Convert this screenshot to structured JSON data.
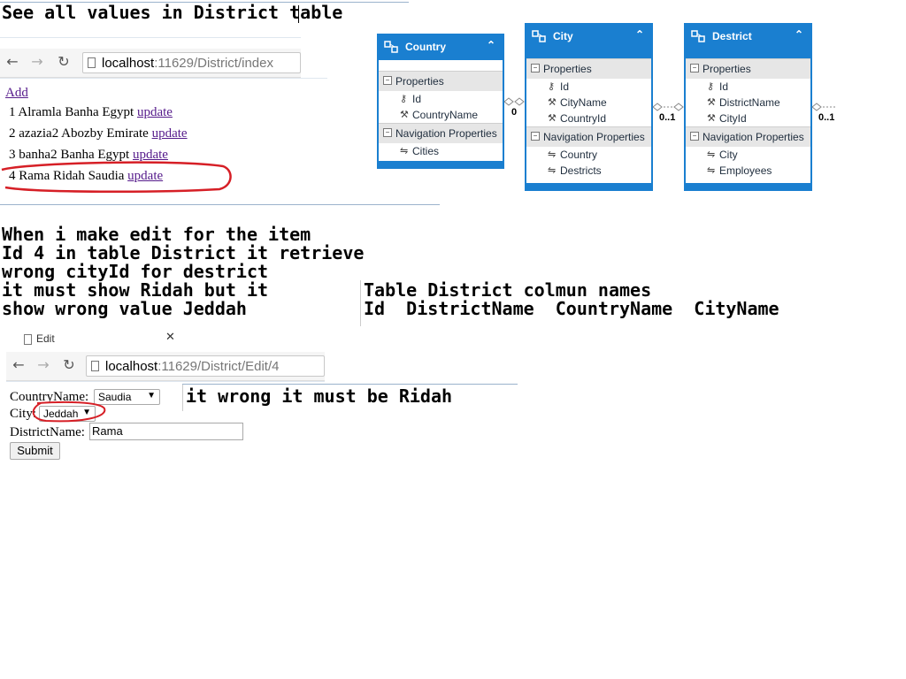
{
  "captions": {
    "top": "See all values in District table",
    "problem": [
      "When i make edit for the item",
      "Id 4 in table District it retrieve",
      "wrong cityId for destrict",
      "it must show Ridah but it",
      "show wrong value Jeddah"
    ],
    "columns_title": "Table District colmun names",
    "columns": "Id  DistrictName  CountryName  CityName",
    "wrong": "it wrong it must be Ridah"
  },
  "index_browser": {
    "url_host": "localhost",
    "url_rest": ":11629/District/index"
  },
  "index_page": {
    "add_link": "Add",
    "rows": [
      {
        "text": "1 Alramla Banha Egypt",
        "link": "update"
      },
      {
        "text": "2 azazia2 Abozby Emirate",
        "link": "update"
      },
      {
        "text": "3 banha2 Banha Egypt",
        "link": "update"
      },
      {
        "text": "4 Rama Ridah Saudia",
        "link": "update"
      }
    ]
  },
  "diagram": {
    "colors": {
      "header": "#1a7fd0",
      "section": "#e6e6e6"
    },
    "country": {
      "title": "Country",
      "properties_label": "Properties",
      "props": [
        "Id",
        "CountryName"
      ],
      "nav_label": "Navigation Properties",
      "navs": [
        "Cities"
      ]
    },
    "city": {
      "title": "City",
      "properties_label": "Properties",
      "props": [
        "Id",
        "CityName",
        "CountryId"
      ],
      "nav_label": "Navigation Properties",
      "navs": [
        "Country",
        "Destricts"
      ]
    },
    "district": {
      "title": "Destrict",
      "properties_label": "Properties",
      "props": [
        "Id",
        "DistrictName",
        "CityId"
      ],
      "nav_label": "Navigation Properties",
      "navs": [
        "City",
        "Employees"
      ]
    },
    "cardinalities": {
      "c1": "0",
      "c2": "0..1",
      "c3": "0..1"
    }
  },
  "edit_tab": {
    "title": "Edit"
  },
  "edit_browser": {
    "url_host": "localhost",
    "url_rest": ":11629/District/Edit/4"
  },
  "edit_form": {
    "country_label": "CountryName:",
    "country_value": "Saudia",
    "city_label": "City:",
    "city_value": "Jeddah",
    "district_label": "DistrictName:",
    "district_value": "Rama",
    "submit": "Submit"
  },
  "annotation_color": "#d61f26"
}
